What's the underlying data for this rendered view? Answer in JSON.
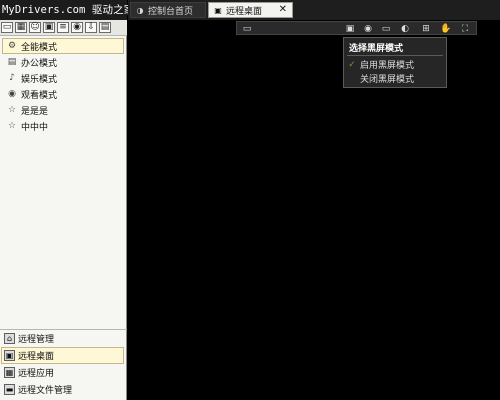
{
  "watermark": "MyDrivers.com 驱动之家",
  "left_toolbar": {
    "icons": [
      "window-icon",
      "calendar-icon",
      "person-icon",
      "monitor-icon",
      "list-icon",
      "globe-icon",
      "download-icon",
      "book-icon"
    ]
  },
  "modes": [
    {
      "label": "全能模式",
      "icon": "gear-icon",
      "active": true
    },
    {
      "label": "办公模式",
      "icon": "document-icon",
      "active": false
    },
    {
      "label": "娱乐模式",
      "icon": "music-icon",
      "active": false
    },
    {
      "label": "观看模式",
      "icon": "eye-icon",
      "active": false
    },
    {
      "label": "是是是",
      "icon": "star-icon",
      "active": false
    },
    {
      "label": "中中中",
      "icon": "star-icon",
      "active": false
    }
  ],
  "bottom_nav": [
    {
      "label": "远程管理",
      "icon": "house-icon",
      "active": false
    },
    {
      "label": "远程桌面",
      "icon": "monitor-icon",
      "active": true
    },
    {
      "label": "远程应用",
      "icon": "grid-icon",
      "active": false
    },
    {
      "label": "远程文件管理",
      "icon": "folder-icon",
      "active": false
    }
  ],
  "tabs": {
    "home_label": "控制台首页",
    "remote_label": "远程桌面",
    "close_glyph": "✕"
  },
  "remote_toolbar": {
    "icons": [
      "screen-icon",
      "monitor-icon",
      "eye-icon",
      "window-icon",
      "palette-icon",
      "plus-icon",
      "hand-icon",
      "fullscreen-icon"
    ]
  },
  "dropdown": {
    "title": "选择黑屏模式",
    "items": [
      {
        "label": "启用黑屏模式",
        "checked": true
      },
      {
        "label": "关闭黑屏模式",
        "checked": false
      }
    ]
  },
  "colors": {
    "accent_active": "#fff8d6",
    "dropdown_bg": "#262626",
    "check": "#5ea33a"
  }
}
